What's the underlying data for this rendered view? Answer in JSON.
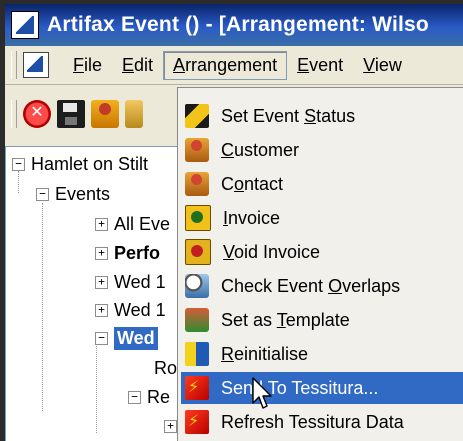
{
  "window": {
    "title": "Artifax Event () - [Arrangement: Wilso"
  },
  "menubar": {
    "items": [
      {
        "label": "File",
        "underline": "F"
      },
      {
        "label": "Edit",
        "underline": "E"
      },
      {
        "label": "Arrangement",
        "underline": "A",
        "active": true
      },
      {
        "label": "Event",
        "underline": "E"
      },
      {
        "label": "View",
        "underline": "V"
      }
    ]
  },
  "toolbar": {
    "buttons": [
      "stop-icon",
      "save-icon",
      "contacts-icon",
      "person-icon"
    ]
  },
  "tree": {
    "rows": [
      {
        "label": "Hamlet on Stilt",
        "expander": "−"
      },
      {
        "label": "Events",
        "expander": "−"
      },
      {
        "label": "All Eve",
        "expander": "+"
      },
      {
        "label": "Perfo",
        "expander": "+",
        "bold": true
      },
      {
        "label": "Wed 1",
        "expander": "+"
      },
      {
        "label": "Wed 1",
        "expander": "+"
      },
      {
        "label": "Wed",
        "expander": "−",
        "selected": true
      },
      {
        "label": "Ro",
        "expander": ""
      },
      {
        "label": "Re",
        "expander": "−"
      },
      {
        "label": "",
        "expander": "+"
      }
    ]
  },
  "dropdown": {
    "items": [
      {
        "pre": "Set Event ",
        "u": "S",
        "post": "tatus",
        "icon": "event-status-icon"
      },
      {
        "pre": "",
        "u": "C",
        "post": "ustomer",
        "icon": "customer-icon"
      },
      {
        "pre": "C",
        "u": "o",
        "post": "ntact",
        "icon": "contact-icon"
      },
      {
        "pre": "",
        "u": "I",
        "post": "nvoice",
        "icon": "invoice-icon"
      },
      {
        "pre": "",
        "u": "V",
        "post": "oid Invoice",
        "icon": "void-invoice-icon"
      },
      {
        "pre": "Check Event ",
        "u": "O",
        "post": "verlaps",
        "icon": "check-overlaps-icon"
      },
      {
        "pre": "Set as ",
        "u": "T",
        "post": "emplate",
        "icon": "template-icon"
      },
      {
        "pre": "",
        "u": "R",
        "post": "einitialise",
        "icon": "reinitialise-icon"
      },
      {
        "pre": "Send To Tessitura...",
        "u": "",
        "post": "",
        "icon": "tessitura-send-icon",
        "hover": true
      },
      {
        "pre": "Refresh Tessitura Data",
        "u": "",
        "post": "",
        "icon": "tessitura-refresh-icon"
      }
    ]
  }
}
